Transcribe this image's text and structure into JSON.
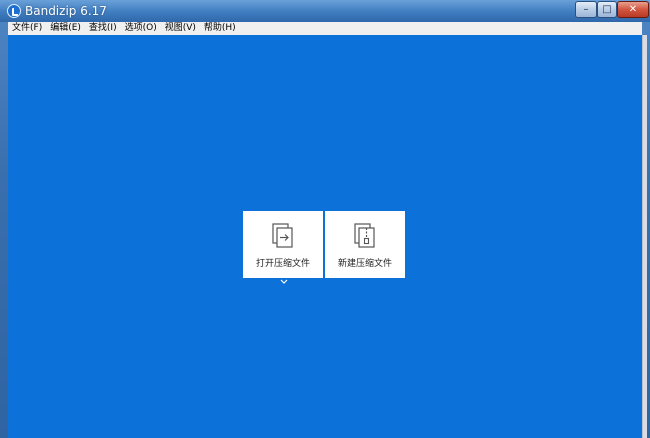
{
  "window": {
    "title": "Bandizip 6.17",
    "controls": {
      "minimize": "–",
      "maximize": "□",
      "close": "✕"
    }
  },
  "menubar": {
    "items": [
      "文件(F)",
      "编辑(E)",
      "查找(I)",
      "选项(O)",
      "视图(V)",
      "帮助(H)"
    ]
  },
  "main": {
    "background_color": "#0c72d9",
    "cards": [
      {
        "label": "打开压缩文件",
        "icon": "open-archive-icon"
      },
      {
        "label": "新建压缩文件",
        "icon": "new-archive-icon"
      }
    ],
    "dropdown_icon": "chevron-down-icon"
  }
}
